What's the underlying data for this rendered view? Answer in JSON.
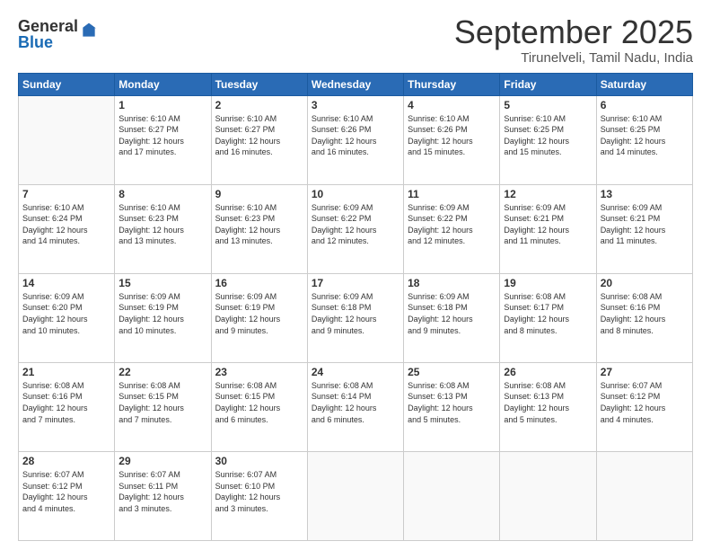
{
  "logo": {
    "general": "General",
    "blue": "Blue"
  },
  "header": {
    "month": "September 2025",
    "location": "Tirunelveli, Tamil Nadu, India"
  },
  "days_of_week": [
    "Sunday",
    "Monday",
    "Tuesday",
    "Wednesday",
    "Thursday",
    "Friday",
    "Saturday"
  ],
  "weeks": [
    [
      {
        "day": "",
        "info": ""
      },
      {
        "day": "1",
        "info": "Sunrise: 6:10 AM\nSunset: 6:27 PM\nDaylight: 12 hours\nand 17 minutes."
      },
      {
        "day": "2",
        "info": "Sunrise: 6:10 AM\nSunset: 6:27 PM\nDaylight: 12 hours\nand 16 minutes."
      },
      {
        "day": "3",
        "info": "Sunrise: 6:10 AM\nSunset: 6:26 PM\nDaylight: 12 hours\nand 16 minutes."
      },
      {
        "day": "4",
        "info": "Sunrise: 6:10 AM\nSunset: 6:26 PM\nDaylight: 12 hours\nand 15 minutes."
      },
      {
        "day": "5",
        "info": "Sunrise: 6:10 AM\nSunset: 6:25 PM\nDaylight: 12 hours\nand 15 minutes."
      },
      {
        "day": "6",
        "info": "Sunrise: 6:10 AM\nSunset: 6:25 PM\nDaylight: 12 hours\nand 14 minutes."
      }
    ],
    [
      {
        "day": "7",
        "info": "Sunrise: 6:10 AM\nSunset: 6:24 PM\nDaylight: 12 hours\nand 14 minutes."
      },
      {
        "day": "8",
        "info": "Sunrise: 6:10 AM\nSunset: 6:23 PM\nDaylight: 12 hours\nand 13 minutes."
      },
      {
        "day": "9",
        "info": "Sunrise: 6:10 AM\nSunset: 6:23 PM\nDaylight: 12 hours\nand 13 minutes."
      },
      {
        "day": "10",
        "info": "Sunrise: 6:09 AM\nSunset: 6:22 PM\nDaylight: 12 hours\nand 12 minutes."
      },
      {
        "day": "11",
        "info": "Sunrise: 6:09 AM\nSunset: 6:22 PM\nDaylight: 12 hours\nand 12 minutes."
      },
      {
        "day": "12",
        "info": "Sunrise: 6:09 AM\nSunset: 6:21 PM\nDaylight: 12 hours\nand 11 minutes."
      },
      {
        "day": "13",
        "info": "Sunrise: 6:09 AM\nSunset: 6:21 PM\nDaylight: 12 hours\nand 11 minutes."
      }
    ],
    [
      {
        "day": "14",
        "info": "Sunrise: 6:09 AM\nSunset: 6:20 PM\nDaylight: 12 hours\nand 10 minutes."
      },
      {
        "day": "15",
        "info": "Sunrise: 6:09 AM\nSunset: 6:19 PM\nDaylight: 12 hours\nand 10 minutes."
      },
      {
        "day": "16",
        "info": "Sunrise: 6:09 AM\nSunset: 6:19 PM\nDaylight: 12 hours\nand 9 minutes."
      },
      {
        "day": "17",
        "info": "Sunrise: 6:09 AM\nSunset: 6:18 PM\nDaylight: 12 hours\nand 9 minutes."
      },
      {
        "day": "18",
        "info": "Sunrise: 6:09 AM\nSunset: 6:18 PM\nDaylight: 12 hours\nand 9 minutes."
      },
      {
        "day": "19",
        "info": "Sunrise: 6:08 AM\nSunset: 6:17 PM\nDaylight: 12 hours\nand 8 minutes."
      },
      {
        "day": "20",
        "info": "Sunrise: 6:08 AM\nSunset: 6:16 PM\nDaylight: 12 hours\nand 8 minutes."
      }
    ],
    [
      {
        "day": "21",
        "info": "Sunrise: 6:08 AM\nSunset: 6:16 PM\nDaylight: 12 hours\nand 7 minutes."
      },
      {
        "day": "22",
        "info": "Sunrise: 6:08 AM\nSunset: 6:15 PM\nDaylight: 12 hours\nand 7 minutes."
      },
      {
        "day": "23",
        "info": "Sunrise: 6:08 AM\nSunset: 6:15 PM\nDaylight: 12 hours\nand 6 minutes."
      },
      {
        "day": "24",
        "info": "Sunrise: 6:08 AM\nSunset: 6:14 PM\nDaylight: 12 hours\nand 6 minutes."
      },
      {
        "day": "25",
        "info": "Sunrise: 6:08 AM\nSunset: 6:13 PM\nDaylight: 12 hours\nand 5 minutes."
      },
      {
        "day": "26",
        "info": "Sunrise: 6:08 AM\nSunset: 6:13 PM\nDaylight: 12 hours\nand 5 minutes."
      },
      {
        "day": "27",
        "info": "Sunrise: 6:07 AM\nSunset: 6:12 PM\nDaylight: 12 hours\nand 4 minutes."
      }
    ],
    [
      {
        "day": "28",
        "info": "Sunrise: 6:07 AM\nSunset: 6:12 PM\nDaylight: 12 hours\nand 4 minutes."
      },
      {
        "day": "29",
        "info": "Sunrise: 6:07 AM\nSunset: 6:11 PM\nDaylight: 12 hours\nand 3 minutes."
      },
      {
        "day": "30",
        "info": "Sunrise: 6:07 AM\nSunset: 6:10 PM\nDaylight: 12 hours\nand 3 minutes."
      },
      {
        "day": "",
        "info": ""
      },
      {
        "day": "",
        "info": ""
      },
      {
        "day": "",
        "info": ""
      },
      {
        "day": "",
        "info": ""
      }
    ]
  ]
}
